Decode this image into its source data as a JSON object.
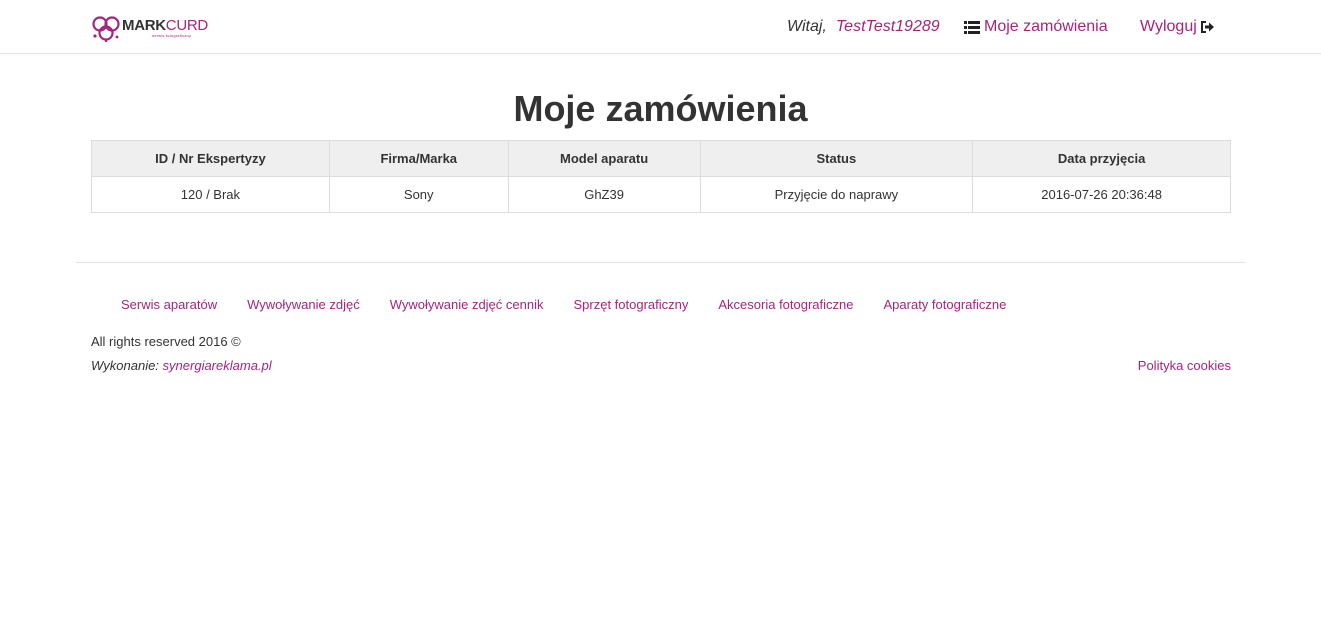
{
  "brand": {
    "name_part1": "MARK",
    "name_part2": "CURD",
    "tagline": "serwis fotograficzny"
  },
  "header": {
    "greeting": "Witaj,",
    "username": "TestTest19289",
    "orders_link": "Moje zamówienia",
    "logout_link": "Wyloguj"
  },
  "main": {
    "title": "Moje zamówienia",
    "table": {
      "columns": [
        "ID / Nr Ekspertyzy",
        "Firma/Marka",
        "Model aparatu",
        "Status",
        "Data przyjęcia"
      ],
      "rows": [
        [
          "120 / Brak",
          "Sony",
          "GhZ39",
          "Przyjęcie do naprawy",
          "2016-07-26 20:36:48"
        ]
      ]
    }
  },
  "footer": {
    "links": [
      "Serwis aparatów",
      "Wywoływanie zdjęć",
      "Wywoływanie zdjęć cennik",
      "Sprzęt fotograficzny",
      "Akcesoria fotograficzne",
      "Aparaty fotograficzne"
    ],
    "rights": "All rights reserved 2016 ©",
    "made_by_label": "Wykonanie:",
    "made_by_link": "synergiareklama.pl",
    "cookies_link": "Polityka cookies"
  },
  "colors": {
    "accent": "#a3267c",
    "text": "#333333",
    "table_header_bg": "#efefef",
    "border": "#dddddd"
  },
  "icons": {
    "orders": "list-icon",
    "logout": "sign-out-icon"
  }
}
